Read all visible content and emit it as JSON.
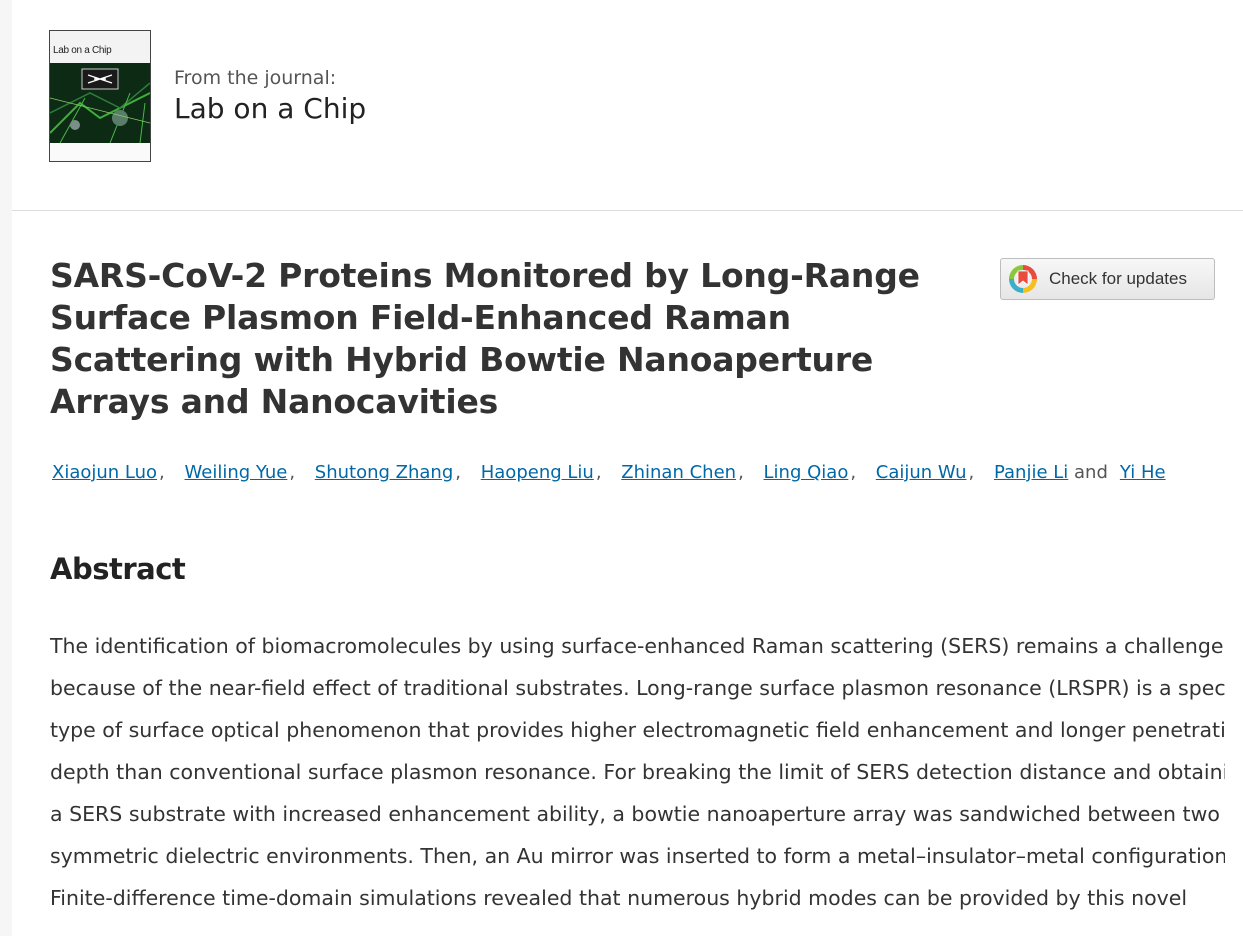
{
  "journal": {
    "cover_title": "Lab on a Chip",
    "from_label": "From the journal:",
    "name": "Lab on a Chip"
  },
  "article": {
    "title": "SARS-CoV-2 Proteins Monitored by Long-Range Surface Plasmon Field-Enhanced Raman Scattering with Hybrid Bowtie Nanoaperture Arrays and Nanocavities"
  },
  "check_updates": {
    "label": "Check for updates",
    "icon": "crossmark-icon"
  },
  "authors": {
    "names": [
      "Xiaojun Luo",
      "Weiling Yue",
      "Shutong Zhang",
      "Haopeng Liu",
      "Zhinan Chen",
      "Ling Qiao",
      "Caijun Wu",
      "Panjie Li",
      "Yi He"
    ],
    "separator": ",",
    "and_label": "and"
  },
  "abstract": {
    "heading": "Abstract",
    "lines": [
      "The identification of biomacromolecules by using surface-enhanced Raman scattering (SERS) remains a challenge",
      "because of the near-field effect of traditional substrates. Long-range surface plasmon resonance (LRSPR) is a special",
      "type of surface optical phenomenon that provides higher electromagnetic field enhancement and longer penetration",
      "depth than conventional surface plasmon resonance. For breaking the limit of SERS detection distance and obtaining",
      "a SERS substrate with increased enhancement ability, a bowtie nanoaperture array was sandwiched between two",
      "symmetric dielectric environments. Then, an Au mirror was inserted to form a metal–insulator–metal configuration.",
      "Finite-difference time-domain simulations revealed that numerous hybrid modes can be provided by this novel"
    ]
  },
  "colors": {
    "link": "#0068a8",
    "text": "#333333",
    "divider": "#dcdcdc"
  }
}
